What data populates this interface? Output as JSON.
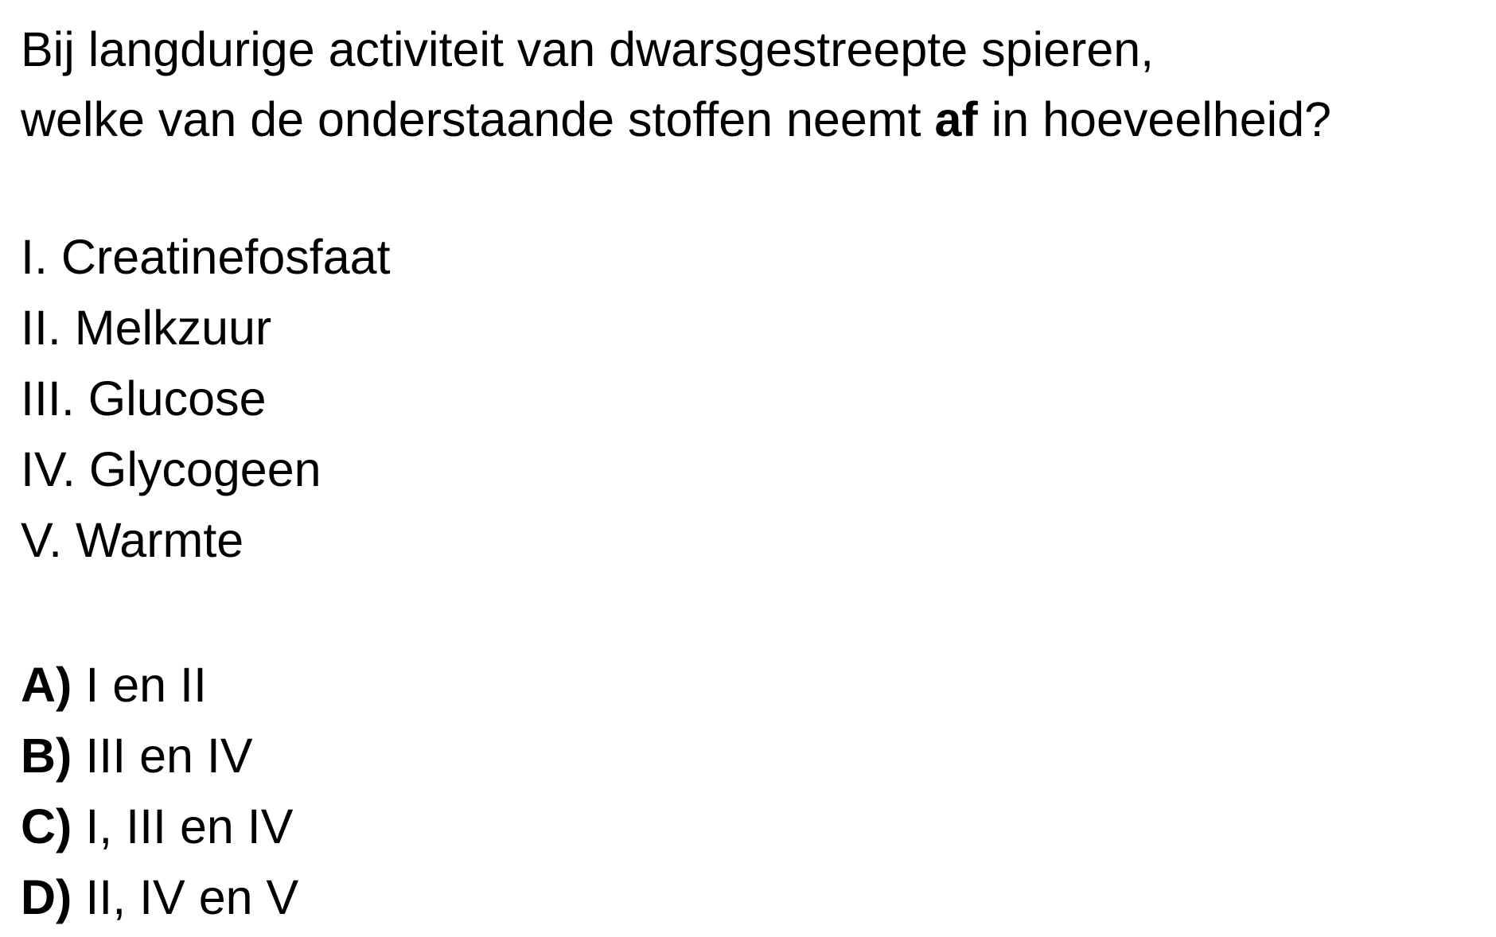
{
  "question": {
    "line1": "Bij langdurige activiteit van dwarsgestreepte spieren,",
    "line2_before": "welke van de onderstaande stoffen neemt ",
    "line2_bold": "af",
    "line2_after": " in hoeveelheid?"
  },
  "items": [
    "I. Creatinefosfaat",
    "II. Melkzuur",
    "III. Glucose",
    "IV. Glycogeen",
    "V. Warmte"
  ],
  "answers": [
    {
      "letter": "A)",
      "text": " I en II"
    },
    {
      "letter": "B)",
      "text": " III en IV"
    },
    {
      "letter": "C)",
      "text": " I, III en IV"
    },
    {
      "letter": "D)",
      "text": " II, IV en V"
    }
  ]
}
